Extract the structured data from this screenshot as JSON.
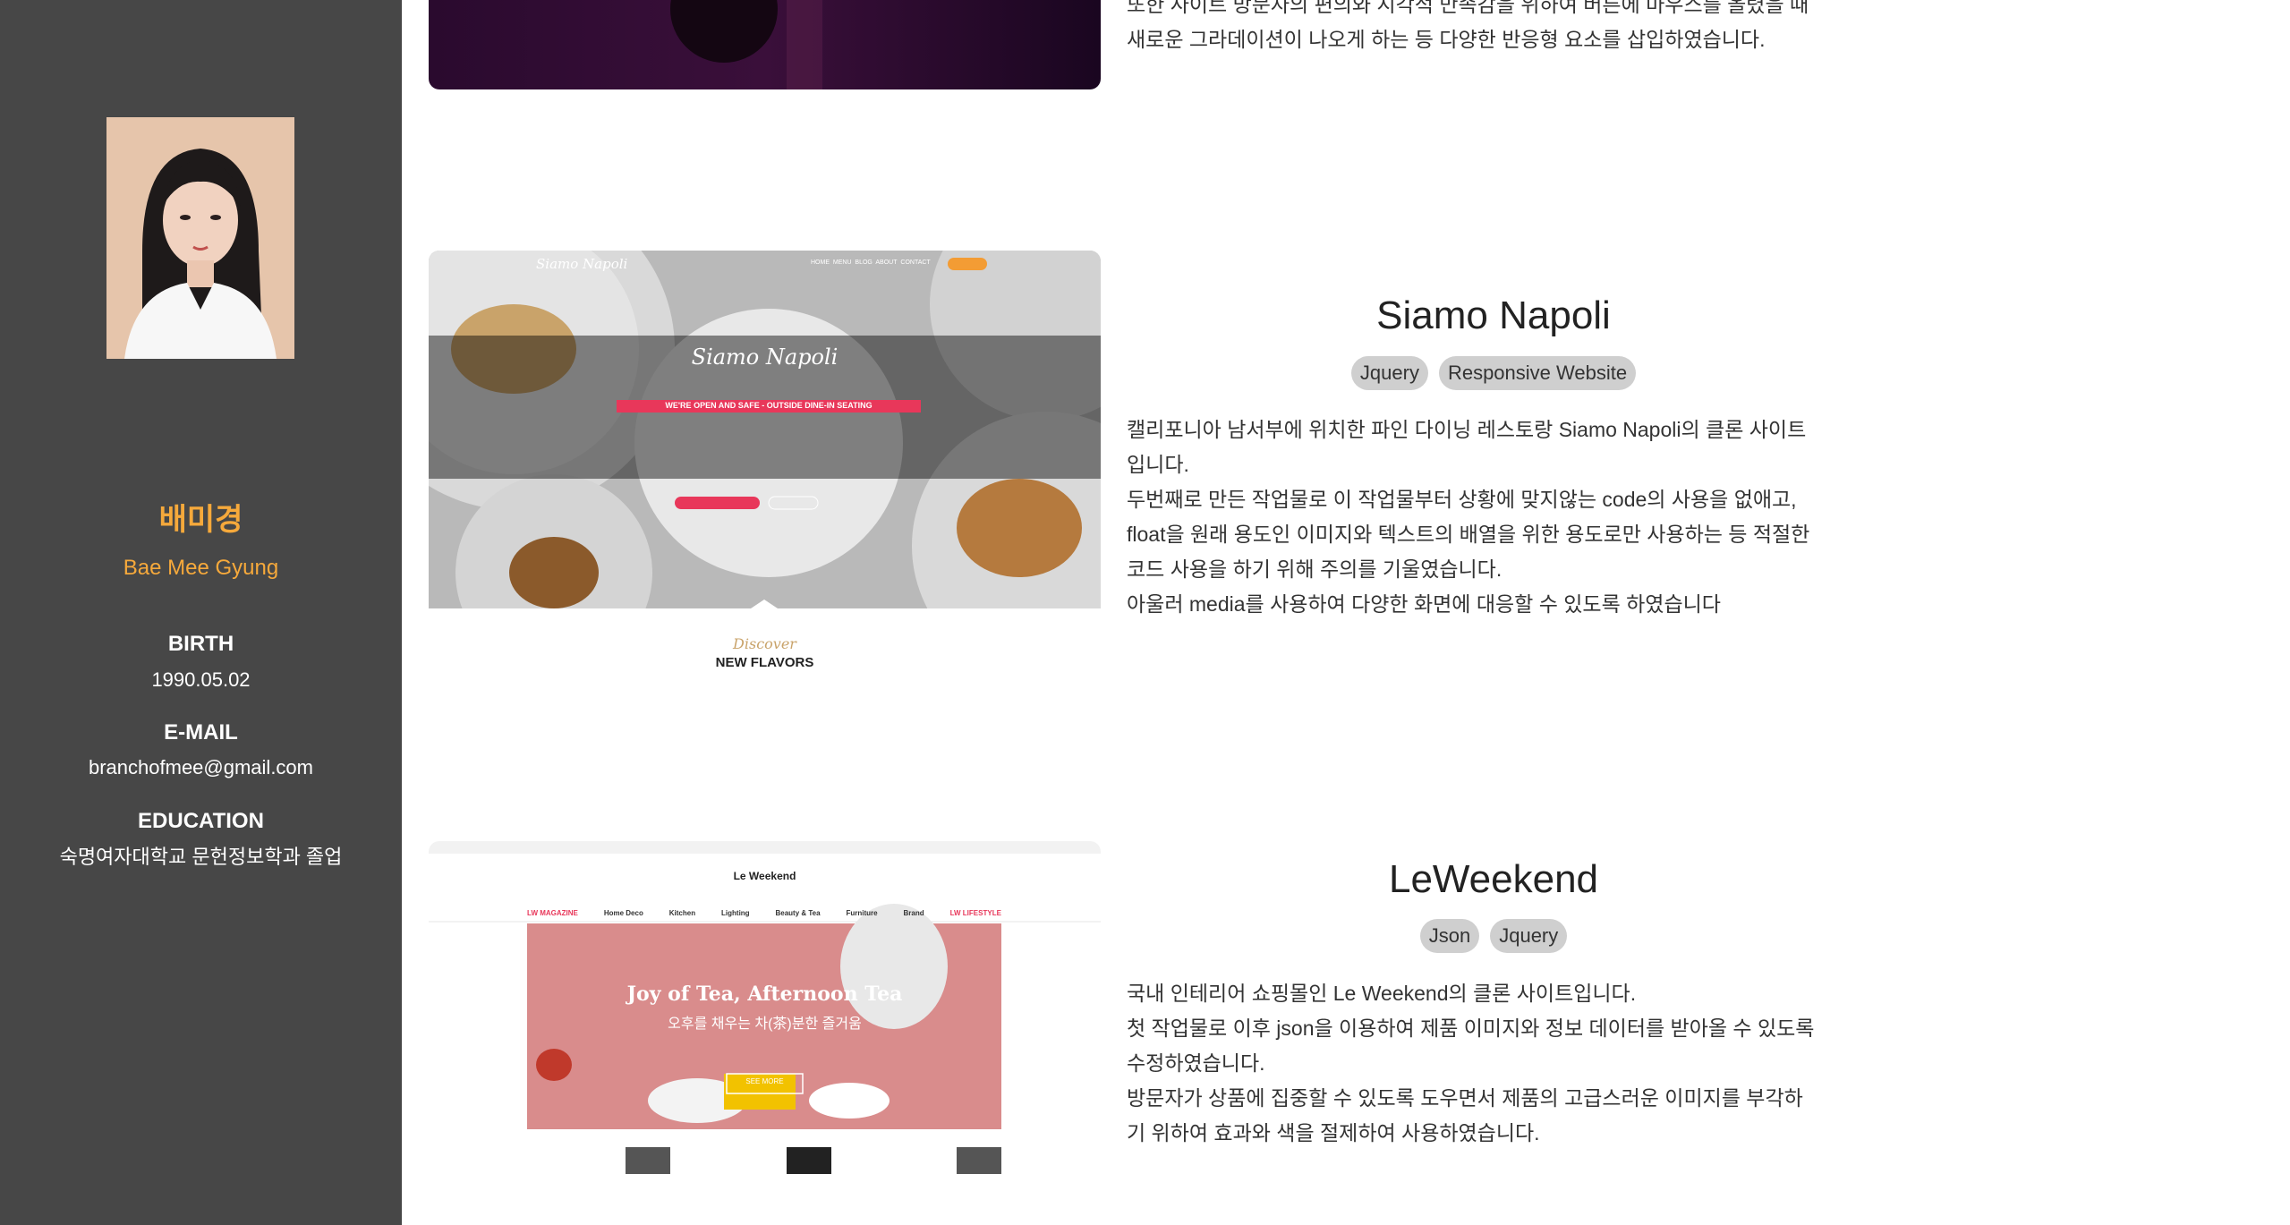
{
  "profile": {
    "name_ko": "배미경",
    "name_en": "Bae Mee Gyung",
    "birth_label": "BIRTH",
    "birth_value": "1990.05.02",
    "email_label": "E-MAIL",
    "email_value": "branchofmee@gmail.com",
    "education_label": "EDUCATION",
    "education_value": "숙명여자대학교 문헌정보학과 졸업"
  },
  "projects": [
    {
      "title": "",
      "tags": [],
      "description": [
        "또한 사이트 방문자의 편의와 시각적 만족감을 위하여 버튼에 마우스를 올렸을 때",
        "새로운 그라데이션이 나오게 하는 등 다양한 반응형 요소를 삽입하였습니다."
      ]
    },
    {
      "title": "Siamo Napoli",
      "tags": [
        "Jquery",
        "Responsive Website"
      ],
      "description": [
        "캘리포니아 남서부에 위치한 파인 다이닝 레스토랑 Siamo Napoli의 클론 사이트",
        "입니다.",
        "두번째로 만든 작업물로 이 작업물부터 상황에 맞지않는 code의 사용을 없애고,",
        "float을 원래 용도인 이미지와 텍스트의 배열을 위한 용도로만 사용하는 등 적절한",
        "코드 사용을 하기 위해 주의를 기울였습니다.",
        "아울러 media를 사용하여 다양한 화면에 대응할 수 있도록 하였습니다"
      ],
      "thumbnail": {
        "logo": "Siamo Napoli",
        "nav": [
          "HOME",
          "MENU",
          "BLOG",
          "ABOUT",
          "CONTACT"
        ],
        "banner": "WE'RE OPEN AND SAFE - OUTSIDE DINE-IN SEATING",
        "discover": "Discover",
        "new_flavors": "NEW FLAVORS"
      }
    },
    {
      "title": "LeWeekend",
      "tags": [
        "Json",
        "Jquery"
      ],
      "description": [
        "국내 인테리어 쇼핑몰인 Le Weekend의 클론 사이트입니다.",
        "첫 작업물로 이후 json을 이용하여 제품 이미지와 정보 데이터를 받아올 수 있도록",
        "수정하였습니다.",
        "방문자가 상품에 집중할 수 있도록 도우면서 제품의 고급스러운 이미지를 부각하",
        "기 위하여 효과와 색을 절제하여 사용하였습니다."
      ],
      "thumbnail": {
        "logo": "Le Weekend",
        "nav": [
          "LW MAGAZINE",
          "Home Deco",
          "Kitchen",
          "Lighting",
          "Beauty & Tea",
          "Furniture",
          "Brand",
          "LW LIFESTYLE"
        ],
        "hero_title": "Joy of Tea, Afternoon Tea",
        "hero_sub": "오후를 채우는 차(茶)분한 즐거움",
        "hero_button": "SEE MORE"
      }
    }
  ],
  "colors": {
    "sidebar_bg": "#474747",
    "accent": "#f6a93b",
    "tag_bg": "#cfcfcf"
  }
}
